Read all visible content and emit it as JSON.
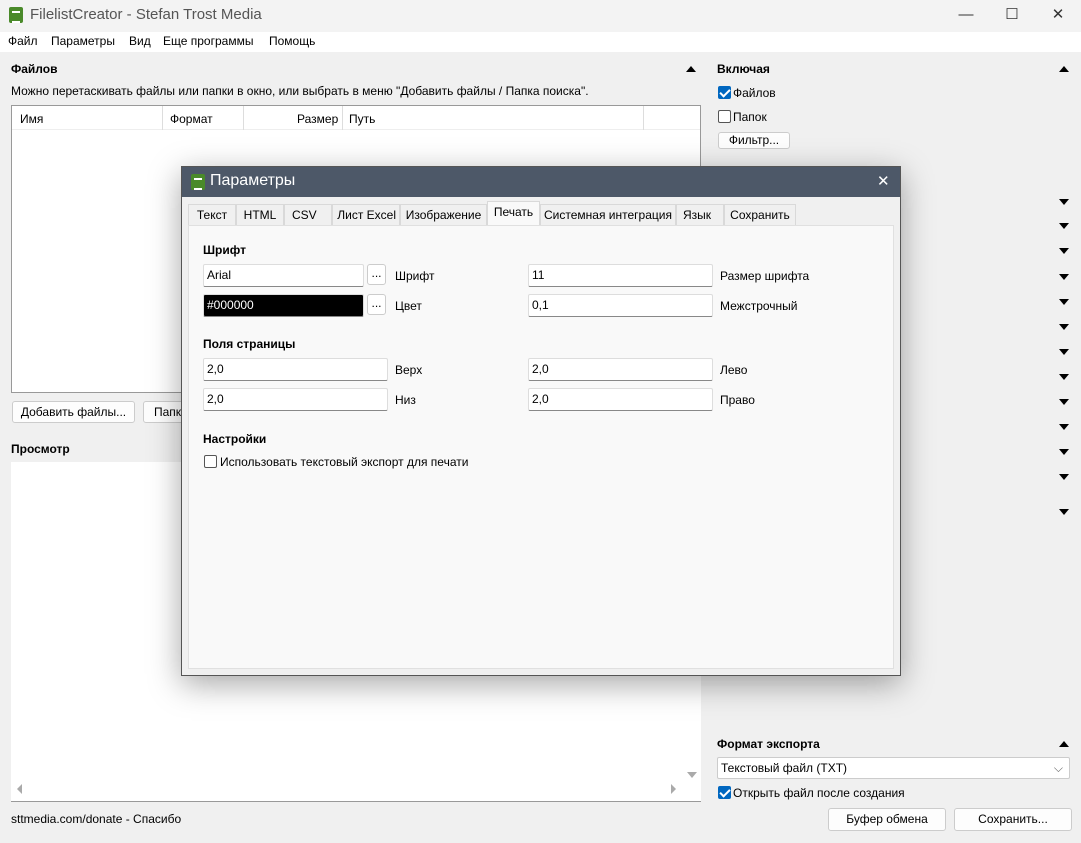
{
  "window": {
    "title": "FilelistCreator - Stefan Trost Media",
    "minimize": "—",
    "maximize": "☐",
    "close": "✕"
  },
  "menu": [
    "Файл",
    "Параметры",
    "Вид",
    "Еще программы",
    "Помощь"
  ],
  "files": {
    "header": "Файлов",
    "hint": "Можно перетаскивать файлы или папки в окно, или выбрать в меню \"Добавить файлы / Папка поиска\".",
    "columns": [
      "Имя",
      "Формат",
      "Размер",
      "Путь"
    ],
    "add_files": "Добавить файлы...",
    "search_folder": "Папк"
  },
  "preview": {
    "header": "Просмотр"
  },
  "status": "sttmedia.com/donate - Спасибо",
  "include": {
    "header": "Включая",
    "files_label": "Файлов",
    "files_checked": true,
    "folders_label": "Папок",
    "folders_checked": false,
    "filter": "Фильтр..."
  },
  "export": {
    "header": "Формат экспорта",
    "format": "Текстовый файл (TXT)",
    "open_after_label": "Открыть файл после создания",
    "open_after_checked": true,
    "clipboard": "Буфер обмена",
    "save": "Сохранить..."
  },
  "dialog": {
    "title": "Параметры",
    "close": "✕",
    "tabs": [
      "Текст",
      "HTML",
      "CSV",
      "Лист Excel",
      "Изображение",
      "Печать",
      "Системная интеграция",
      "Язык",
      "Сохранить"
    ],
    "active_tab": "Печать",
    "font_section": "Шрифт",
    "font_value": "Arial",
    "font_label": "Шрифт",
    "font_size_value": "11",
    "font_size_label": "Размер шрифта",
    "color_value": "#000000",
    "color_label": "Цвет",
    "line_spacing_value": "0,1",
    "line_spacing_label": "Межстрочный",
    "dots": "...",
    "margins_section": "Поля страницы",
    "top_value": "2,0",
    "top_label": "Верх",
    "left_value": "2,0",
    "left_label": "Лево",
    "bottom_value": "2,0",
    "bottom_label": "Низ",
    "right_value": "2,0",
    "right_label": "Право",
    "settings_section": "Настройки",
    "text_export_label": "Использовать текстовый экспорт для печати",
    "text_export_checked": false
  }
}
